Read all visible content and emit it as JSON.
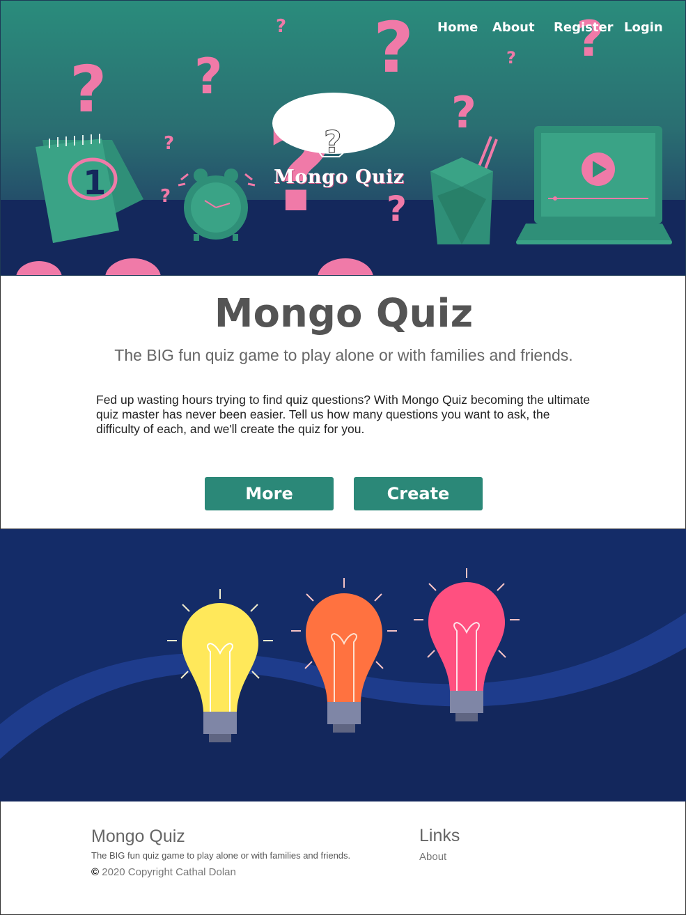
{
  "nav": {
    "home": "Home",
    "about": "About",
    "register": "Register",
    "login": "Login"
  },
  "hero": {
    "logo_text": "Mongo Quiz",
    "calendar_day": "1"
  },
  "intro": {
    "title": "Mongo Quiz",
    "subtitle": "The BIG fun quiz game to play alone or with families and friends.",
    "description": "Fed up wasting hours trying to find quiz questions? With Mongo Quiz becoming the ultimate quiz master has never been easier. Tell us how many questions you want to ask, the difficulty of each, and we'll create the quiz for you.",
    "more_label": "More",
    "create_label": "Create"
  },
  "footer": {
    "title": "Mongo Quiz",
    "subtitle": "The BIG fun quiz game to play alone or with families and friends.",
    "copyright_symbol": "©",
    "copyright": "2020 Copyright Cathal Dolan",
    "links_title": "Links",
    "links": [
      "About"
    ]
  },
  "colors": {
    "accent": "#2b8878",
    "pink": "#f07aa8",
    "navy": "#142c68"
  }
}
